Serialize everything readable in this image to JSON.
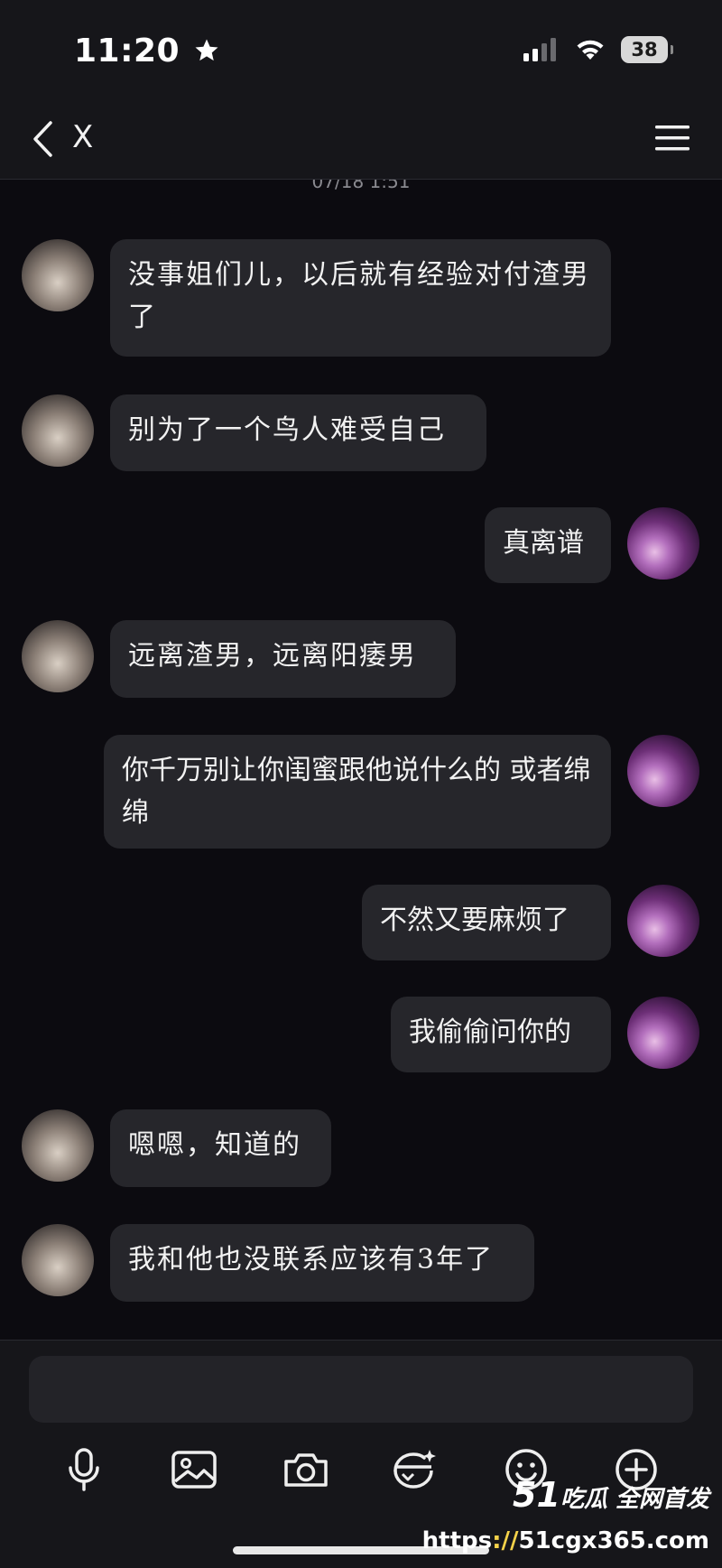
{
  "status_bar": {
    "time": "11:20",
    "battery": "38",
    "icons": [
      "star-icon",
      "cellular-signal-icon",
      "wifi-icon",
      "battery-icon"
    ]
  },
  "nav": {
    "title": "X",
    "back_icon": "chevron-left-icon",
    "menu_icon": "hamburger-menu-icon"
  },
  "chat": {
    "timestamp": "07/18 1:51",
    "messages": [
      {
        "side": "left",
        "text": "没事姐们儿，以后就有经验对付渣男了"
      },
      {
        "side": "left",
        "text": "别为了一个鸟人难受自己"
      },
      {
        "side": "right",
        "text": "真离谱"
      },
      {
        "side": "left",
        "text": "远离渣男，远离阳痿男"
      },
      {
        "side": "right",
        "text": "你千万别让你闺蜜跟他说什么的 或者绵绵"
      },
      {
        "side": "right",
        "text": "不然又要麻烦了"
      },
      {
        "side": "right",
        "text": "我偷偷问你的"
      },
      {
        "side": "left",
        "text": "嗯嗯，知道的"
      },
      {
        "side": "left",
        "text": "我和他也没联系应该有3年了"
      }
    ]
  },
  "composer": {
    "input_value": "",
    "tools": [
      "microphone-icon",
      "image-icon",
      "camera-icon",
      "sticker-icon",
      "emoji-icon",
      "add-icon"
    ]
  },
  "watermark": {
    "brand_number": "51",
    "brand_text": "吃瓜 全网首发",
    "url_prefix": "https",
    "url_rest": "51cgx365.com"
  },
  "colors": {
    "background": "#0c0b10",
    "bubble": "#26262b",
    "bar": "#16161a",
    "text": "#f2f2f2"
  }
}
